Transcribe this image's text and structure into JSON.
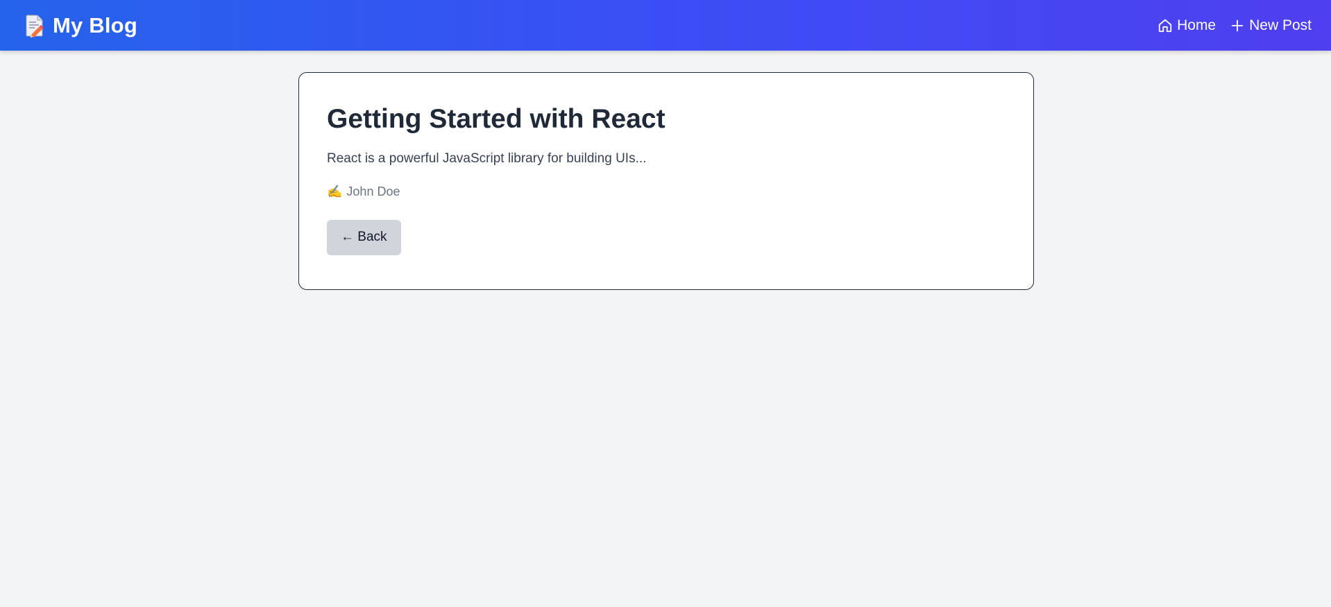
{
  "header": {
    "brand": "My Blog",
    "brand_icon": "memo-icon",
    "nav": [
      {
        "label": "Home",
        "icon": "home-icon"
      },
      {
        "label": "New Post",
        "icon": "plus-icon"
      }
    ],
    "gradient_start": "#2563eb",
    "gradient_end": "#4f3ff0"
  },
  "post": {
    "title": "Getting Started with React",
    "excerpt": "React is a powerful JavaScript library for building UIs...",
    "author_icon": "writing-hand-icon",
    "author_glyph": "✍️",
    "author": "John Doe",
    "back_label": "← Back"
  },
  "colors": {
    "background": "#f3f4f6",
    "button_bg": "#d1d5db",
    "title": "#1f2937"
  }
}
